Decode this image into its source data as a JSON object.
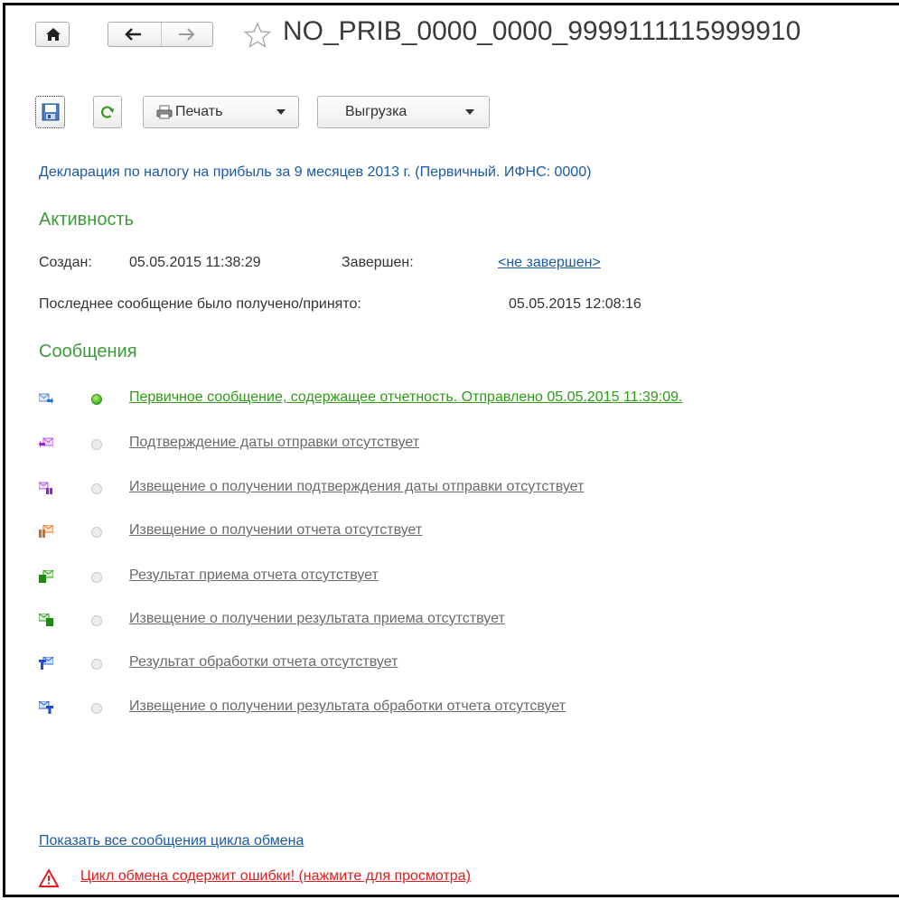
{
  "header": {
    "title": "NO_PRIB_0000_0000_9999111115999910",
    "home_icon": "home-icon",
    "back_icon": "arrow-left-icon",
    "forward_icon": "arrow-right-icon",
    "favorite_icon": "star-outline-icon"
  },
  "toolbar": {
    "save_icon": "save-to-disk-icon",
    "refresh_icon": "refresh-icon",
    "print_label": "Печать",
    "export_label": "Выгрузка"
  },
  "document_link": "Декларация по налогу на прибыль за 9 месяцев 2013 г. (Первичный. ИФНС: 0000)",
  "activity": {
    "heading": "Активность",
    "created_label": "Создан:",
    "created_value": "05.05.2015 11:38:29",
    "finished_label": "Завершен:",
    "finished_value": "<не завершен>",
    "last_message_label": "Последнее сообщение было получено/принято:",
    "last_message_value": "05.05.2015 12:08:16"
  },
  "messages": {
    "heading": "Сообщения",
    "items": [
      {
        "text": "Первичное сообщение, содержащее отчетность. Отправлено 05.05.2015 11:39:09.",
        "status": "received",
        "icon": "envelope-outgoing-icon"
      },
      {
        "text": "Подтверждение даты отправки отсутствует",
        "status": "absent",
        "icon": "envelope-confirmation-icon"
      },
      {
        "text": "Извещение о получении подтверждения даты отправки отсутствует",
        "status": "absent",
        "icon": "envelope-notice-icon"
      },
      {
        "text": "Извещение о получении отчета отсутствует",
        "status": "absent",
        "icon": "envelope-report-notice-icon"
      },
      {
        "text": "Результат приема отчета отсутствует",
        "status": "absent",
        "icon": "envelope-acceptance-result-icon"
      },
      {
        "text": "Извещение о получении результата приема отсутствует",
        "status": "absent",
        "icon": "envelope-acceptance-notice-icon"
      },
      {
        "text": "Результат обработки отчета отсутствует",
        "status": "absent",
        "icon": "envelope-processing-result-icon"
      },
      {
        "text": "Извещение о получении результата обработки отчета отсутсвует",
        "status": "absent",
        "icon": "envelope-processing-notice-icon"
      }
    ]
  },
  "show_all_link": "Показать все сообщения цикла обмена",
  "error": {
    "icon": "warning-triangle-icon",
    "text": "Цикл обмена содержит ошибки! (нажмите для просмотра)"
  },
  "colors": {
    "link_blue": "#1a5aa8",
    "section_green": "#3c9c3c",
    "status_green": "#2e9a17",
    "error_red": "#e11d1d"
  }
}
